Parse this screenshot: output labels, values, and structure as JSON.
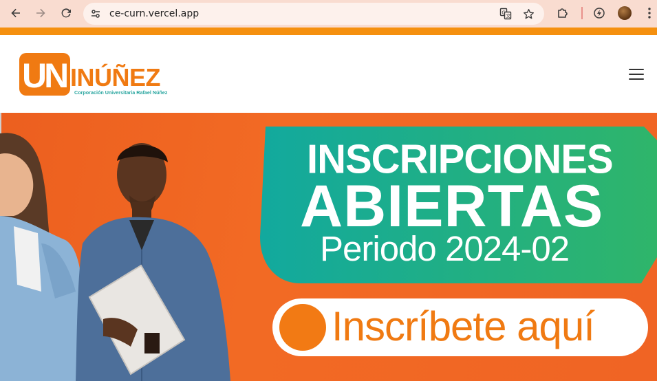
{
  "browser": {
    "url": "ce-curn.vercel.app",
    "icons": {
      "back": "arrow-left-icon",
      "forward": "arrow-right-icon",
      "reload": "reload-icon",
      "site_info": "tune-icon",
      "translate": "translate-icon",
      "bookmark": "star-icon",
      "extensions": "puzzle-icon",
      "performance": "lightning-icon",
      "menu": "three-dots-icon"
    }
  },
  "header": {
    "logo": {
      "mark": "UN",
      "name": "INÚÑEZ",
      "tagline": "Corporación Universitaria Rafael Núñez"
    },
    "menu_icon": "hamburger-icon"
  },
  "hero": {
    "line1": "INSCRIPCIONES",
    "line2": "ABIERTAS",
    "line3": "Periodo 2024-02",
    "cta_label": "Inscríbete aquí"
  },
  "colors": {
    "chrome_bg": "#f9dcd0",
    "accent_orange": "#f5900f",
    "hero_orange": "#f06424",
    "panel_green_start": "#12a99e",
    "panel_green_end": "#2fb56a",
    "cta_orange": "#f07a12",
    "logo_teal": "#2aa6a0"
  }
}
